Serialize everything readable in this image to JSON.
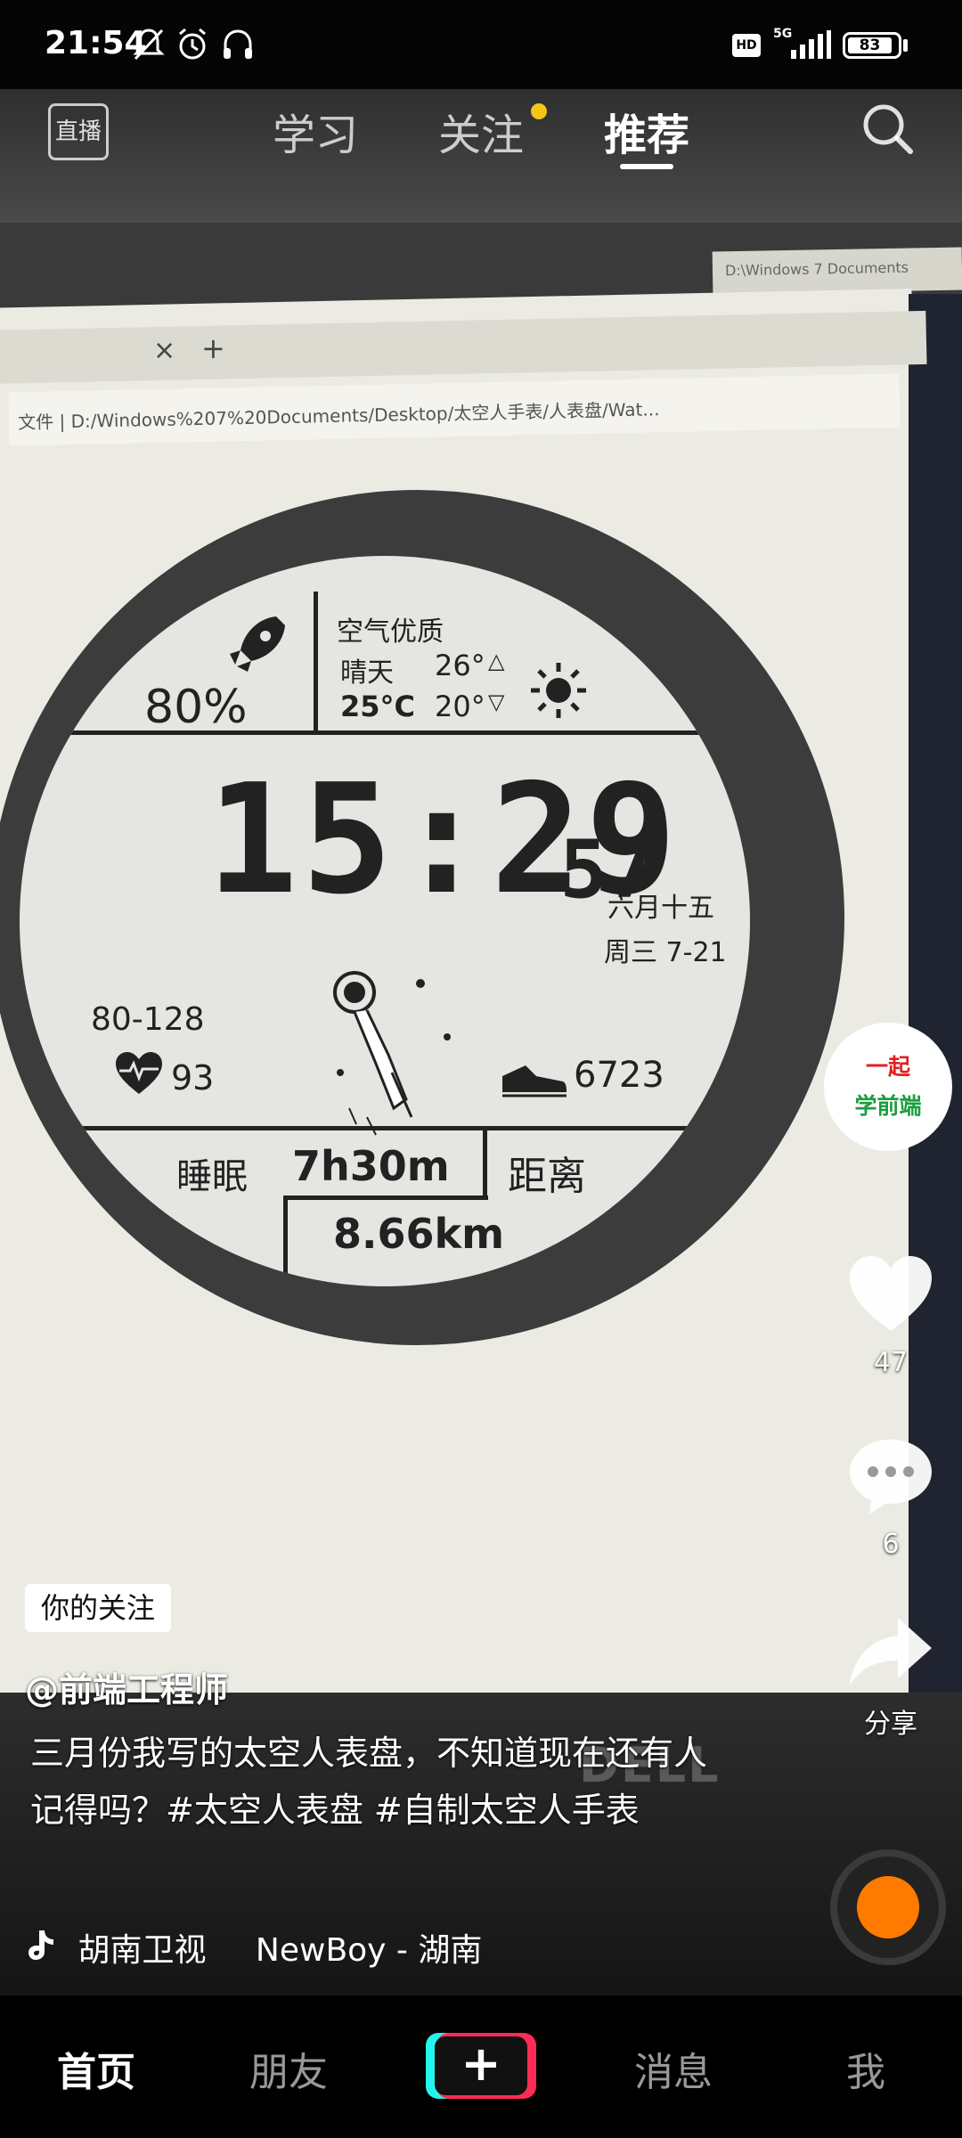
{
  "status_bar": {
    "time": "21:54",
    "network": "5G",
    "hd": "HD",
    "battery": "83"
  },
  "top_nav": {
    "live_label": "直播",
    "tabs": [
      {
        "label": "学习",
        "active": false
      },
      {
        "label": "关注",
        "active": false,
        "dot": true
      },
      {
        "label": "推荐",
        "active": true
      }
    ]
  },
  "video": {
    "browser_tab_close": "×",
    "browser_tab_new": "+",
    "address": "文件 | D:/Windows%207%20Documents/Desktop/太空人手表/人表盘/Wat...",
    "window_title": "D:\\Windows 7 Documents",
    "brand": "DELL",
    "watch": {
      "battery_percent": "80%",
      "air_quality": "空气优质",
      "weather": "晴天",
      "temp_high": "26°",
      "temp_current": "25°C",
      "temp_low": "20°",
      "time_hm": "15:29",
      "time_s": "57",
      "lunar_date": "六月十五",
      "weekday_date": "周三 7-21",
      "heart_range": "80-128",
      "heart_rate": "93",
      "steps": "6723",
      "sleep_label": "睡眠",
      "sleep_value": "7h30m",
      "distance_label": "距离",
      "distance_value": "8.66km"
    }
  },
  "author_avatar": {
    "line1": "一起",
    "line2": "学前端"
  },
  "actions": {
    "like_count": "47",
    "comment_count": "6",
    "share_label": "分享"
  },
  "caption": {
    "follow_badge": "你的关注",
    "author": "@前端工程师",
    "text": "三月份我写的太空人表盘，不知道现在还有人记得吗？#太空人表盘 #自制太空人手表",
    "music_source": "胡南卫视",
    "music_track": "NewBoy - 湖南"
  },
  "bottom_nav": {
    "items": [
      {
        "label": "首页",
        "active": true
      },
      {
        "label": "朋友",
        "active": false
      },
      {
        "label": "+",
        "active": false
      },
      {
        "label": "消息",
        "active": false
      },
      {
        "label": "我",
        "active": false
      }
    ]
  },
  "colors": {
    "accent_red": "#fe2c55",
    "accent_cyan": "#25f4ee",
    "notify_dot": "#f5c518"
  }
}
